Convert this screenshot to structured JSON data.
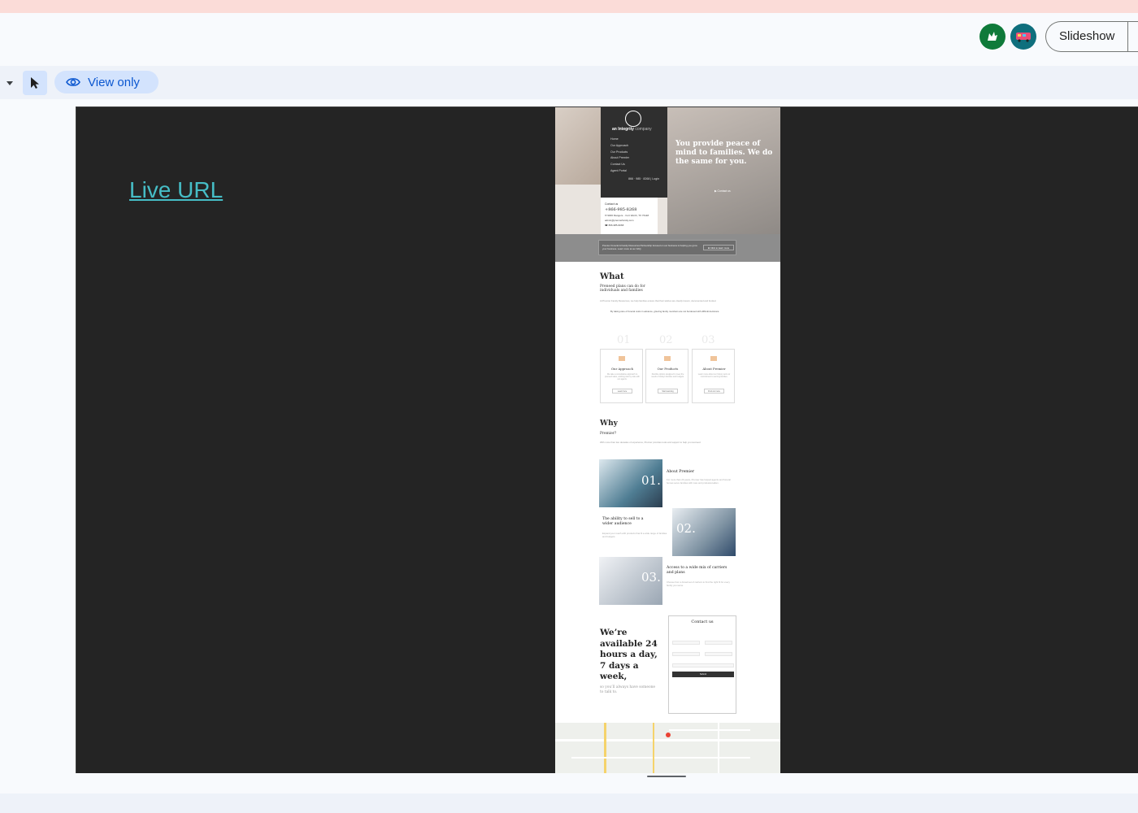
{
  "header": {
    "slideshow_label": "Slideshow",
    "avatars": [
      {
        "name": "avatar-user-1",
        "color": "#0f7a3a",
        "icon": "animal-icon"
      },
      {
        "name": "avatar-user-2",
        "color": "#0f6f7d",
        "icon": "bus-icon"
      }
    ]
  },
  "toolbar": {
    "mode_label": "View only",
    "cursor_icon": "cursor-icon",
    "eye_icon": "eye-icon"
  },
  "slide": {
    "link_text": "Live URL",
    "link_color": "#46bdc6",
    "background": "#242424"
  },
  "website": {
    "nav": {
      "brand_bold": "an Integrity",
      "brand_light": "company",
      "items": [
        "Home",
        "Our Approach",
        "Our Products",
        "About Premier",
        "Contact Us",
        "Agent Portal"
      ],
      "phone_line": "866 · 985 · 8268 | Login"
    },
    "hero": {
      "title": "You provide peace of mind to families. We do the same for you.",
      "cta": "▶ Contact us"
    },
    "contact": {
      "label": "Contact us",
      "phone": "+866-985-8268",
      "lines": [
        "✉ 9006 Rangers... Fort Worth, TX 76118",
        "admin@premierfamily.com",
        "☎ 866-985-8268"
      ]
    },
    "banner": {
      "text": "Premier Funeral & Family Resources Partnership focused on our business is helping you grow your business. Learn more at our FAQ.",
      "button": "⊕ Click to learn more"
    },
    "what": {
      "title": "What",
      "subtitle": "Preneed plans can do for individuals and families",
      "body": "At Premier Family Resources, we help families ensure that their wishes are clearly known, documented and funded.",
      "quote": "By taking care of funeral costs in advance, grieving family members are not burdened with difficult decisions."
    },
    "cards": [
      {
        "num": "01",
        "title": "Our Approach",
        "body": "We take a consultative approach to preneed sales, working side by side with our agents.",
        "button": "Learn here"
      },
      {
        "num": "02",
        "title": "Our Products",
        "body": "Flexible options designed to meet the needs of today's families and budgets.",
        "button": "Start learning"
      },
      {
        "num": "03",
        "title": "About Premier",
        "body": "Learn more about our history and our commitment to serving families.",
        "button": "Find out more"
      }
    ],
    "why": {
      "title": "Why",
      "subtitle": "Premier?",
      "body": "With more than two decades of experience, Premier provides tools and support to help you succeed."
    },
    "features": [
      {
        "num": "01.",
        "title": "About Premier",
        "body": "For more than 20 years, Premier has helped agents and funeral homes serve families with care and professionalism."
      },
      {
        "num": "02.",
        "title": "The ability to sell to a wider audience",
        "body": "Expand your reach with products that fit a wide range of families and budgets."
      },
      {
        "num": "03.",
        "title": "Access to a wide mix of carriers and plans",
        "body": "Choose from a broad set of carriers to find the right fit for every family you serve."
      }
    ],
    "availability": {
      "title": "We’re available 24 hours a day, 7 days a week,",
      "subtitle": "so you’ll always have someone to talk to."
    },
    "form": {
      "title": "Contact us",
      "submit": "Submit"
    }
  }
}
